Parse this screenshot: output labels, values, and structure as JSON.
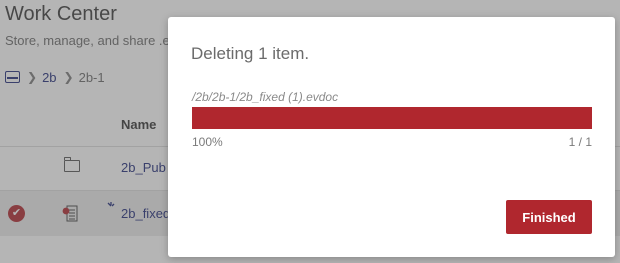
{
  "app": {
    "title": "Work Center",
    "subtitle": "Store, manage, and share .e"
  },
  "breadcrumb": {
    "home_icon": "drive-icon",
    "items": [
      "2b",
      "2b-1"
    ]
  },
  "table": {
    "header_name": "Name",
    "rows": [
      {
        "icon": "folder-icon",
        "name": "2b_Pub",
        "selected": false
      },
      {
        "icon": "document-icon",
        "name": "2b_fixed",
        "selected": true
      }
    ]
  },
  "dialog": {
    "title": "Deleting 1 item.",
    "path": "/2b/2b-1/2b_fixed (1).evdoc",
    "progress": 1.0,
    "percent_label": "100%",
    "count_label": "1 / 1",
    "finished_label": "Finished"
  },
  "colors": {
    "accent": "#b0272e",
    "link": "#1f2a7a"
  }
}
